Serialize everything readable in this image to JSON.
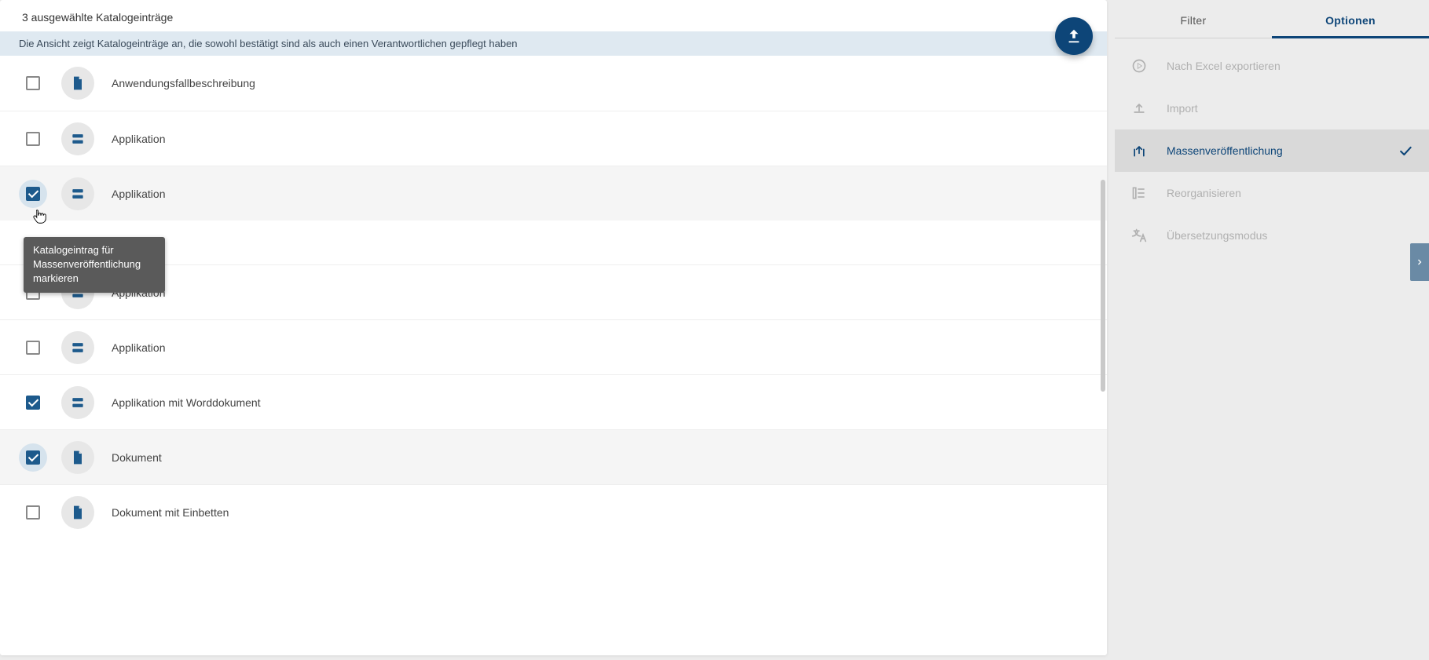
{
  "main": {
    "title": "3 ausgewählte Katalogeinträge",
    "info": "Die Ansicht zeigt Katalogeinträge an, die sowohl bestätigt sind als auch einen Verantwortlichen gepflegt haben",
    "tooltip": "Katalogeintrag für Massenveröffentlichung markieren",
    "items": [
      {
        "label": "Anwendungsfallbeschreibung",
        "icon": "document",
        "checked": false,
        "alt": false,
        "halo": false
      },
      {
        "label": "Applikation",
        "icon": "app",
        "checked": false,
        "alt": false,
        "halo": false
      },
      {
        "label": "Applikation",
        "icon": "app",
        "checked": true,
        "alt": true,
        "halo": true
      },
      {
        "label": "Applikation",
        "icon": "app",
        "checked": false,
        "alt": false,
        "halo": false
      },
      {
        "label": "Applikation",
        "icon": "app",
        "checked": false,
        "alt": false,
        "halo": false
      },
      {
        "label": "Applikation mit Worddokument",
        "icon": "app",
        "checked": true,
        "alt": false,
        "halo": false
      },
      {
        "label": "Dokument",
        "icon": "document",
        "checked": true,
        "alt": true,
        "halo": true
      },
      {
        "label": "Dokument mit Einbetten",
        "icon": "document",
        "checked": false,
        "alt": false,
        "halo": false
      }
    ]
  },
  "side": {
    "tabs": {
      "filter": "Filter",
      "options": "Optionen",
      "active": "options"
    },
    "options": [
      {
        "label": "Nach Excel exportieren",
        "icon": "play",
        "active": false
      },
      {
        "label": "Import",
        "icon": "upload",
        "active": false
      },
      {
        "label": "Massenveröffentlichung",
        "icon": "publish",
        "active": true
      },
      {
        "label": "Reorganisieren",
        "icon": "reorganize",
        "active": false
      },
      {
        "label": "Übersetzungsmodus",
        "icon": "translate",
        "active": false
      }
    ]
  }
}
